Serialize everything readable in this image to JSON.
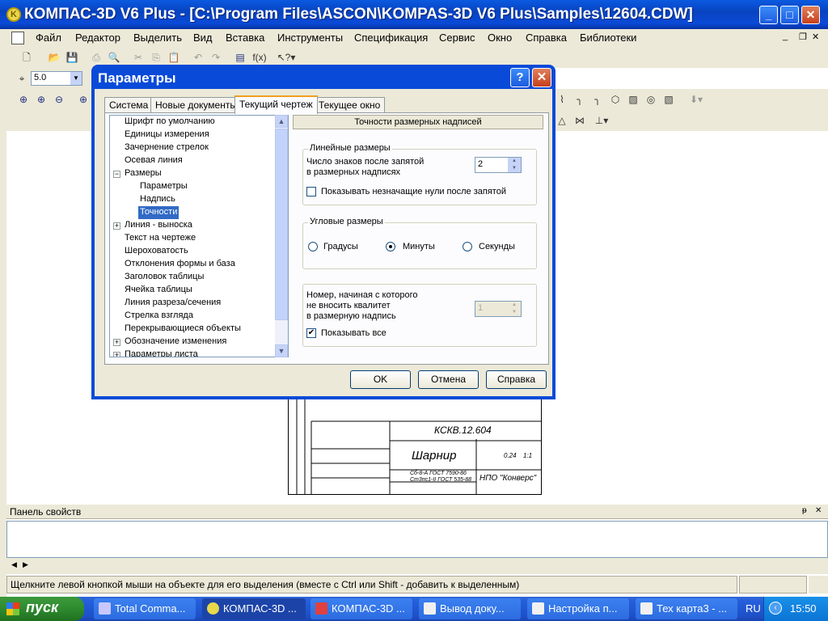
{
  "window": {
    "title": "КОМПАС-3D V6 Plus - [C:\\Program Files\\ASCON\\KOMPAS-3D V6 Plus\\Samples\\12604.CDW]",
    "minimize": "_",
    "maximize": "□",
    "close": "✕"
  },
  "menu": [
    "Файл",
    "Редактор",
    "Выделить",
    "Вид",
    "Вставка",
    "Инструменты",
    "Спецификация",
    "Сервис",
    "Окно",
    "Справка",
    "Библиотеки"
  ],
  "toolbar": {
    "step_value": "5.0"
  },
  "drawing": {
    "designation": "КСКВ.12.604",
    "name": "Шарнир",
    "material_1": "Сб-8-А ГОСТ 7590-86",
    "material_2": "Ст3пс1-II ГОСТ 535-88",
    "company": "НПО \"Конверс\"",
    "mass": "0.24",
    "scale": "1:1"
  },
  "properties_panel": {
    "title": "Панель свойств",
    "pin": "ᵽ",
    "close": "✕"
  },
  "status": {
    "text": "Щелкните левой кнопкой мыши на объекте для его выделения (вместе с Ctrl или Shift - добавить к выделенным)"
  },
  "dialog": {
    "title": "Параметры",
    "help": "?",
    "close": "✕",
    "tabs": [
      "Система",
      "Новые документы",
      "Текущий чертеж",
      "Текущее окно"
    ],
    "active_tab": "Текущий чертеж",
    "tree": [
      {
        "label": "Шрифт по умолчанию"
      },
      {
        "label": "Единицы измерения"
      },
      {
        "label": "Зачернение стрелок"
      },
      {
        "label": "Осевая линия"
      },
      {
        "label": "Размеры",
        "expander": "−"
      },
      {
        "label": "Параметры"
      },
      {
        "label": "Надпись"
      },
      {
        "label": "Точности",
        "selected": true
      },
      {
        "label": "Линия - выноска",
        "expander": "+"
      },
      {
        "label": "Текст на чертеже"
      },
      {
        "label": "Шероховатость"
      },
      {
        "label": "Отклонения формы и база"
      },
      {
        "label": "Заголовок таблицы"
      },
      {
        "label": "Ячейка таблицы"
      },
      {
        "label": "Линия разреза/сечения"
      },
      {
        "label": "Стрелка взгляда"
      },
      {
        "label": "Перекрывающиеся объекты"
      },
      {
        "label": "Обозначение изменения",
        "expander": "+"
      },
      {
        "label": "Параметры листа",
        "expander": "+"
      }
    ],
    "section_heading": "Точности размерных надписей",
    "linear": {
      "title": "Линейные размеры",
      "count_label_1": "Число знаков после запятой",
      "count_label_2": "в размерных надписях",
      "count_value": "2",
      "show_zeros_label": "Показывать незначащие нули после запятой",
      "show_zeros_checked": false
    },
    "angular": {
      "title": "Угловые размеры",
      "options": [
        "Градусы",
        "Минуты",
        "Секунды"
      ],
      "selected": "Минуты"
    },
    "tolerance": {
      "label_1": "Номер, начиная с которого",
      "label_2": "не вносить квалитет",
      "label_3": "в размерную надпись",
      "value": "1",
      "show_all_label": "Показывать все",
      "show_all_checked": true,
      "check_mark": "✔"
    },
    "buttons": {
      "ok": "OK",
      "cancel": "Отмена",
      "help": "Справка"
    }
  },
  "taskbar": {
    "start": "пуск",
    "tasks": [
      {
        "label": "Total Comma..."
      },
      {
        "label": "КОМПАС-3D ..."
      },
      {
        "label": "КОМПАС-3D ..."
      },
      {
        "label": "Вывод доку..."
      },
      {
        "label": "Настройка п..."
      },
      {
        "label": "Тех карта3 - ..."
      }
    ],
    "language": "RU",
    "clock": "15:50"
  },
  "colors": {
    "titlebar": "#0a4ad8",
    "selection": "#316ac5",
    "face": "#ece9d8",
    "start": "#2f8a2f"
  }
}
